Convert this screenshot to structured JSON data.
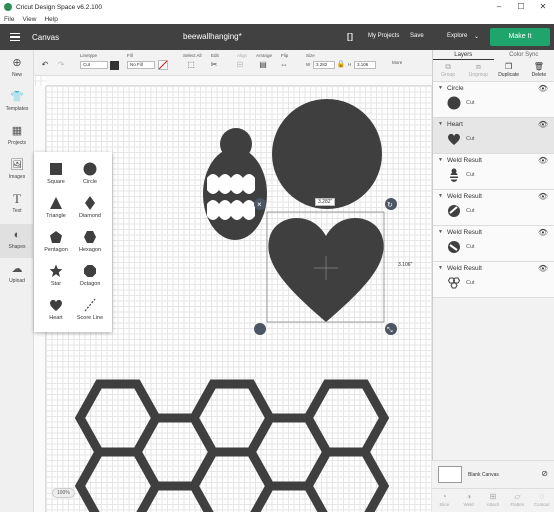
{
  "window": {
    "title": "Cricut Design Space  v6.2.100",
    "controls": [
      "–",
      "☐",
      "✕"
    ]
  },
  "menu": [
    "File",
    "View",
    "Help"
  ],
  "header": {
    "section": "Canvas",
    "project": "beewallhanging*",
    "my_projects": "My Projects",
    "save": "Save",
    "explore": "Explore",
    "make_it": "Make It"
  },
  "toolbar": {
    "linetype_label": "Linetype",
    "linetype_value": "Cut",
    "fill_label": "Fill",
    "fill_value": "No Fill",
    "select_all": "Select All",
    "edit": "Edit",
    "align": "Align",
    "arrange": "Arrange",
    "flip": "Flip",
    "size_label": "Size",
    "w_label": "W",
    "w_value": "3.282",
    "h_label": "H",
    "h_value": "3.106",
    "more": "More"
  },
  "leftbar": [
    {
      "icon": "plus-icon",
      "label": "New"
    },
    {
      "icon": "shirt-icon",
      "label": "Templates"
    },
    {
      "icon": "projects-icon",
      "label": "Projects"
    },
    {
      "icon": "images-icon",
      "label": "Images"
    },
    {
      "icon": "text-icon",
      "label": "Text"
    },
    {
      "icon": "shapes-icon",
      "label": "Shapes"
    },
    {
      "icon": "upload-icon",
      "label": "Upload"
    }
  ],
  "shapes": [
    "Square",
    "Circle",
    "Triangle",
    "Diamond",
    "Pentagon",
    "Hexagon",
    "Star",
    "Octagon",
    "Heart",
    "Score Line"
  ],
  "canvas": {
    "width_label": "3.282\"",
    "height_label": "3.106\"",
    "zoom": "100%"
  },
  "panel": {
    "tabs": [
      "Layers",
      "Color Sync"
    ],
    "actions": [
      "Group",
      "Ungroup",
      "Duplicate",
      "Delete"
    ],
    "layers": [
      {
        "name": "Circle",
        "op": "Cut"
      },
      {
        "name": "Heart",
        "op": "Cut"
      },
      {
        "name": "Weld Result",
        "op": "Cut"
      },
      {
        "name": "Weld Result",
        "op": "Cut"
      },
      {
        "name": "Weld Result",
        "op": "Cut"
      },
      {
        "name": "Weld Result",
        "op": "Cut"
      }
    ],
    "blank_canvas": "Blank Canvas",
    "bottom_actions": [
      "Slice",
      "Weld",
      "Attach",
      "Flatten",
      "Contour"
    ]
  },
  "colors": {
    "header": "#414141",
    "make_it": "#1fa56b",
    "shape": "#3f3f3f"
  }
}
